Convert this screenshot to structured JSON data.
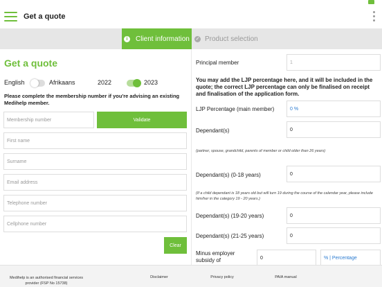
{
  "appbar": {
    "title": "Get a quote"
  },
  "tabs": {
    "active": "Client information",
    "inactive": "Product selection"
  },
  "left": {
    "heading": "Get a quote",
    "lang_english": "English",
    "lang_afrikaans": "Afrikaans",
    "year_2022": "2022",
    "year_2023": "2023",
    "note": "Please complete the membership number if you're advising an existing Medihelp member.",
    "membership_placeholder": "Membership number",
    "validate": "Validate",
    "first_name": "First name",
    "surname": "Surname",
    "email": "Email address",
    "telephone": "Telephone number",
    "cellphone": "Cellphone number",
    "clear": "Clear"
  },
  "right": {
    "principal_label": "Principal member",
    "principal_value": "1",
    "info": "You may add the LJP percentage here, and it will be included in the quote; the correct LJP percentage can only be finalised on receipt and finalisation of the application form.",
    "ljp_label": "LJP Percentage (main member)",
    "ljp_value": "0 %",
    "dep_label": "Dependant(s)",
    "dep_value": "0",
    "dep_hint": "(partner, spouse, grandchild, parents of member or child older than 26 years)",
    "dep018_label": "Dependant(s) (0-18 years)",
    "dep018_value": "0",
    "dep018_hint": "(If a child dependant is 18 years old but will turn 19 during the course of the calendar year, please include him/her in the category 19 - 20 years.)",
    "dep1920_label": "Dependant(s) (19-20 years)",
    "dep1920_value": "0",
    "dep2125_label": "Dependant(s) (21-25 years)",
    "dep2125_value": "0",
    "employer_label": "Minus employer subsidy of",
    "employer_value": "0",
    "employer_unit": "% | Percentage"
  },
  "footer": {
    "fsp": "Medihelp is an authorised financial services provider (FSP No 15738)",
    "disclaimer": "Disclaimer",
    "privacy": "Privacy policy",
    "paia": "PAIA manual"
  },
  "colors": {
    "accent": "#6fbf3b",
    "tabbar": "#e6e6e6"
  }
}
